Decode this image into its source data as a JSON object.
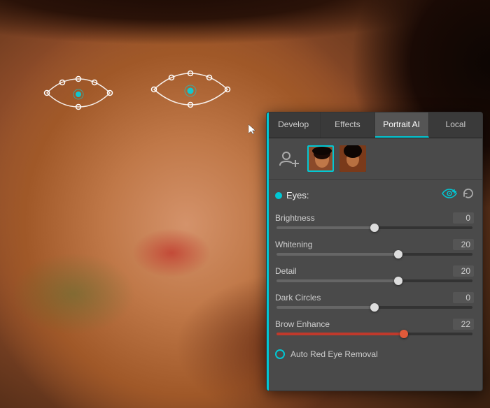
{
  "background": {
    "description": "Portrait photo of woman with dark hair"
  },
  "panel": {
    "tabs": [
      {
        "label": "Develop",
        "active": false
      },
      {
        "label": "Effects",
        "active": false
      },
      {
        "label": "Portrait AI",
        "active": true
      },
      {
        "label": "Local",
        "active": false
      }
    ],
    "portrait_icons": {
      "add_label": "+",
      "portraits": [
        {
          "id": 1,
          "active": true
        },
        {
          "id": 2,
          "active": false
        }
      ]
    },
    "sections": [
      {
        "name": "Eyes",
        "label": "Eyes:",
        "enabled": true,
        "sliders": [
          {
            "label": "Brightness",
            "value": 0,
            "percent": 50
          },
          {
            "label": "Whitening",
            "value": 20,
            "percent": 62
          },
          {
            "label": "Detail",
            "value": 20,
            "percent": 62
          },
          {
            "label": "Dark Circles",
            "value": 0,
            "percent": 50
          },
          {
            "label": "Brow Enhance",
            "value": 22,
            "percent": 65,
            "accent": true
          }
        ],
        "auto_option": {
          "label": "Auto Red Eye Removal",
          "enabled": true
        }
      }
    ]
  },
  "icons": {
    "add_person": "👤",
    "eye_icon": "👁",
    "reset": "↺"
  }
}
